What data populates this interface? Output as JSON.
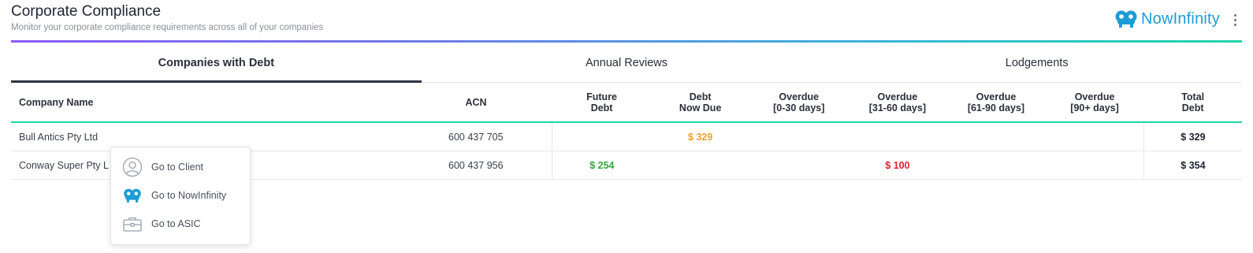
{
  "header": {
    "title": "Corporate Compliance",
    "subtitle": "Monitor your corporate compliance requirements across all of your companies",
    "brand_name": "NowInfinity",
    "brand_logo_icon": "nowinfinity-logo-icon",
    "menu_icon": "kebab-menu-icon",
    "accent_gradient": [
      "#8b5cf6",
      "#3cb5da",
      "#1fd6a8"
    ]
  },
  "tabs": [
    {
      "label": "Companies with Debt",
      "active": true
    },
    {
      "label": "Annual Reviews",
      "active": false
    },
    {
      "label": "Lodgements",
      "active": false
    }
  ],
  "table": {
    "columns": [
      {
        "key": "company",
        "line1": "Company Name",
        "line2": ""
      },
      {
        "key": "acn",
        "line1": "ACN",
        "line2": ""
      },
      {
        "key": "future",
        "line1": "Future",
        "line2": "Debt"
      },
      {
        "key": "due",
        "line1": "Debt",
        "line2": "Now Due"
      },
      {
        "key": "od030",
        "line1": "Overdue",
        "line2": "[0-30 days]"
      },
      {
        "key": "od3160",
        "line1": "Overdue",
        "line2": "[31-60 days]"
      },
      {
        "key": "od6190",
        "line1": "Overdue",
        "line2": "[61-90 days]"
      },
      {
        "key": "od90",
        "line1": "Overdue",
        "line2": "[90+ days]"
      },
      {
        "key": "total",
        "line1": "Total",
        "line2": "Debt"
      }
    ],
    "rows": [
      {
        "company": "Bull Antics Pty Ltd",
        "acn": "600 437 705",
        "future": "",
        "due": "$ 329",
        "od030": "",
        "od3160": "",
        "od6190": "",
        "od90": "",
        "total": "$ 329"
      },
      {
        "company": "Conway Super Pty L",
        "acn": "600 437 956",
        "future": "$ 254",
        "due": "",
        "od030": "",
        "od3160": "$ 100",
        "od6190": "",
        "od90": "",
        "total": "$ 354"
      }
    ],
    "colors": {
      "future": "#3aa63a",
      "due": "#f0a030",
      "overdue": "#e0202a"
    }
  },
  "context_menu": {
    "items": [
      {
        "label": "Go to Client",
        "icon": "user-circle-icon"
      },
      {
        "label": "Go to NowInfinity",
        "icon": "nowinfinity-logo-icon"
      },
      {
        "label": "Go to ASIC",
        "icon": "briefcase-icon"
      }
    ]
  }
}
